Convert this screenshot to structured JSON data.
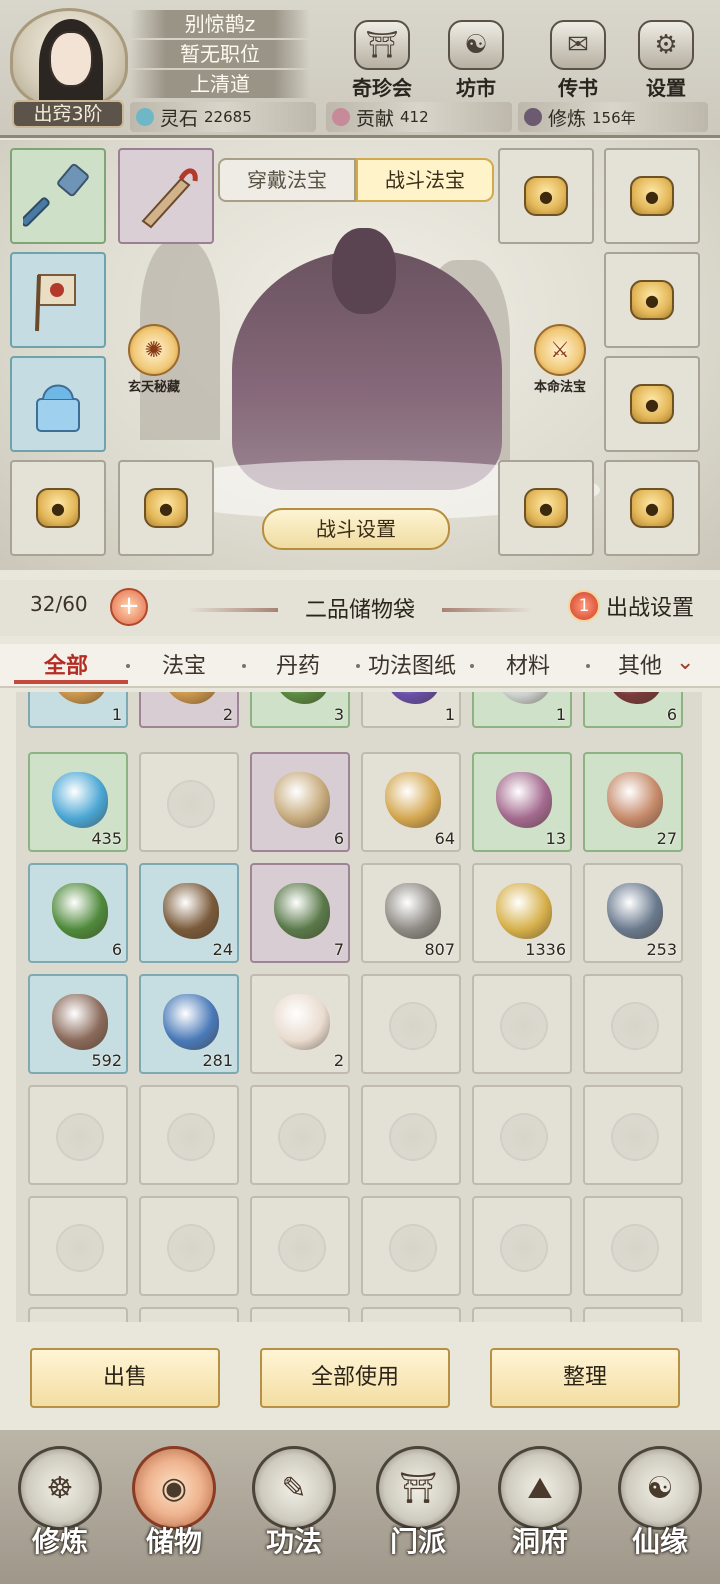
{
  "profile": {
    "name": "别惊鹊z",
    "position": "暂无职位",
    "sect": "上清道",
    "rank": "出窍3阶"
  },
  "top_menu": [
    {
      "label": "奇珍会",
      "icon": "palace-icon"
    },
    {
      "label": "坊市",
      "icon": "market-icon"
    },
    {
      "label": "传书",
      "icon": "letter-icon"
    },
    {
      "label": "设置",
      "icon": "gear-icon"
    }
  ],
  "resources": [
    {
      "name": "灵石",
      "value": "22685",
      "color": "#6fb7c7"
    },
    {
      "name": "贡献",
      "value": "412",
      "color": "#c78a9a"
    },
    {
      "name": "修炼",
      "value": "156年",
      "color": "#6b5a70"
    }
  ],
  "equip_tabs": {
    "inactive": "穿戴法宝",
    "active": "战斗法宝"
  },
  "skills": [
    {
      "label": "玄天秘藏",
      "icon": "swirl-icon"
    },
    {
      "label": "本命法宝",
      "icon": "sword-icon"
    }
  ],
  "battle_settings": "战斗设置",
  "bag": {
    "capacity": "32/60",
    "title": "二品储物袋",
    "deploy_badge": "1",
    "deploy_label": "出战设置"
  },
  "categories": [
    "全部",
    "法宝",
    "丹药",
    "功法图纸",
    "材料",
    "其他"
  ],
  "items_row0": [
    {
      "qty": "1",
      "tier": "blue",
      "color": "#c9954a"
    },
    {
      "qty": "2",
      "tier": "purple",
      "color": "#c9954a"
    },
    {
      "qty": "3",
      "tier": "green",
      "color": "#5b8a3f"
    },
    {
      "qty": "1",
      "tier": "",
      "color": "#6a4fa8"
    },
    {
      "qty": "1",
      "tier": "green",
      "color": "#cfd3cf"
    },
    {
      "qty": "6",
      "tier": "green",
      "color": "#7a3a3a"
    }
  ],
  "items": [
    {
      "qty": "435",
      "tier": "green",
      "color": "#4aa6d4"
    },
    {
      "qty": "",
      "tier": "empty",
      "color": ""
    },
    {
      "qty": "6",
      "tier": "purple",
      "color": "#c7ab7d"
    },
    {
      "qty": "64",
      "tier": "",
      "color": "#d4a750"
    },
    {
      "qty": "13",
      "tier": "green",
      "color": "#a46a8f"
    },
    {
      "qty": "27",
      "tier": "green",
      "color": "#c68a6a"
    },
    {
      "qty": "6",
      "tier": "blue",
      "color": "#4f8a3b"
    },
    {
      "qty": "24",
      "tier": "blue",
      "color": "#7a5a3a"
    },
    {
      "qty": "7",
      "tier": "purple",
      "color": "#5a7a4a"
    },
    {
      "qty": "807",
      "tier": "",
      "color": "#8e8a84"
    },
    {
      "qty": "1336",
      "tier": "",
      "color": "#d6b04a"
    },
    {
      "qty": "253",
      "tier": "",
      "color": "#6a7a8e"
    },
    {
      "qty": "592",
      "tier": "blue",
      "color": "#8a6a5a"
    },
    {
      "qty": "281",
      "tier": "blue",
      "color": "#4a7ab8"
    },
    {
      "qty": "2",
      "tier": "",
      "color": "#e9dccf"
    }
  ],
  "actions": [
    "出售",
    "全部使用",
    "整理"
  ],
  "nav": [
    {
      "label": "修炼",
      "icon": "meditate-icon"
    },
    {
      "label": "储物",
      "icon": "bag-icon"
    },
    {
      "label": "功法",
      "icon": "scroll-icon"
    },
    {
      "label": "门派",
      "icon": "gate-icon"
    },
    {
      "label": "洞府",
      "icon": "cave-icon"
    },
    {
      "label": "仙缘",
      "icon": "yinyang-icon"
    }
  ]
}
